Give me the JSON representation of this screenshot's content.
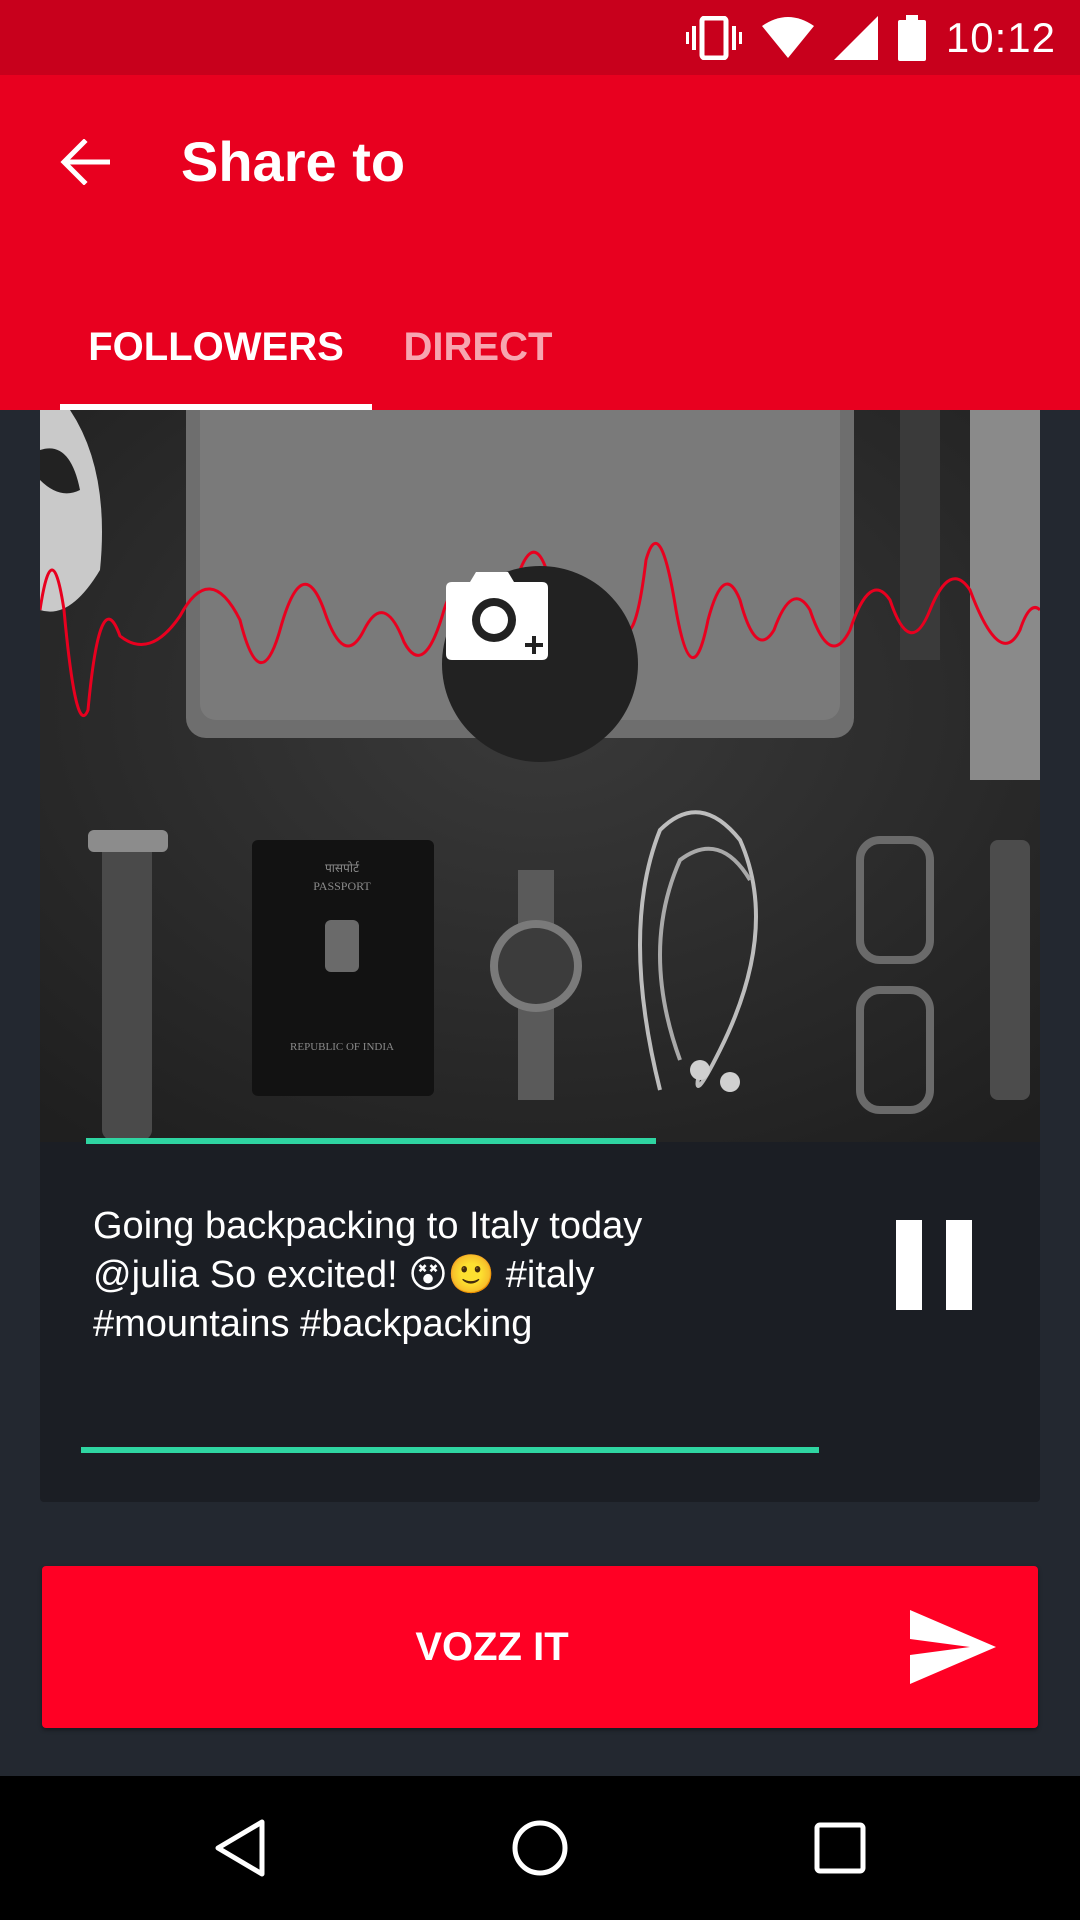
{
  "status_bar": {
    "time": "10:12",
    "icons": [
      "vibrate-icon",
      "wifi-icon",
      "signal-icon",
      "battery-icon"
    ]
  },
  "app_bar": {
    "title": "Share to",
    "back_icon": "arrow-back-icon",
    "tabs": [
      {
        "label": "FOLLOWERS",
        "selected": true
      },
      {
        "label": "DIRECT",
        "selected": false
      }
    ]
  },
  "card": {
    "add_photo_icon": "camera-plus-icon",
    "playback_progress": 0.57,
    "caption": "Going backpacking to Italy today\n@julia So excited! 😵🙂 #italy\n#mountains #backpacking",
    "pause_icon": "pause-icon"
  },
  "action": {
    "label": "VOZZ IT",
    "icon": "send-icon"
  },
  "nav_bar": {
    "icons": [
      "back-triangle-icon",
      "home-circle-icon",
      "recents-square-icon"
    ]
  },
  "colors": {
    "status_bar": "#c8001c",
    "app_bar": "#e8001f",
    "accent": "#2fd5a2",
    "button": "#ff0024",
    "background": "#232830",
    "card": "#1b1e24"
  }
}
